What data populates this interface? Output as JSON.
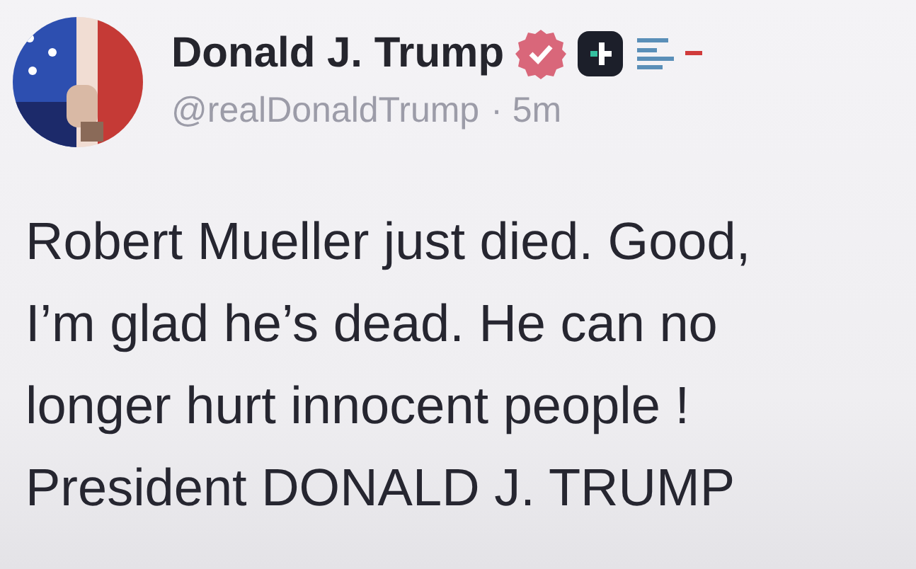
{
  "post": {
    "author": {
      "name": "Donald J. Trump",
      "verified": true,
      "handle": "@realDonaldTrump",
      "separator": "·",
      "time": "5m"
    },
    "body_lines": [
      "Robert Mueller just died. Good,",
      "I’m glad he’s dead. He can no",
      "longer hurt innocent people !",
      "President DONALD J. TRUMP"
    ]
  }
}
